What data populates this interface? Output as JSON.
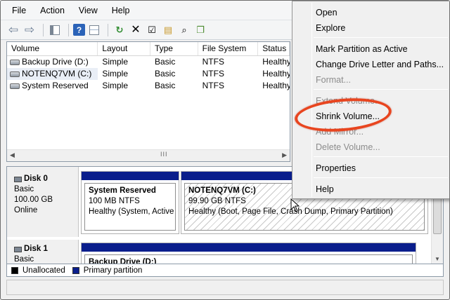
{
  "menubar": {
    "items": [
      "File",
      "Action",
      "View",
      "Help"
    ]
  },
  "toolbar": {
    "buttons": [
      "back-icon",
      "forward-icon",
      "show-hide-console-tree-icon",
      "help-icon",
      "properties-icon",
      "refresh-icon",
      "delete-icon",
      "action-icon",
      "open-icon",
      "search-icon",
      "export-icon"
    ]
  },
  "volume_list": {
    "columns": [
      "Volume",
      "Layout",
      "Type",
      "File System",
      "Status"
    ],
    "rows": [
      {
        "volume": "Backup Drive (D:)",
        "layout": "Simple",
        "type": "Basic",
        "fs": "NTFS",
        "status": "Healthy"
      },
      {
        "volume": "NOTENQ7VM (C:)",
        "layout": "Simple",
        "type": "Basic",
        "fs": "NTFS",
        "status": "Healthy"
      },
      {
        "volume": "System Reserved",
        "layout": "Simple",
        "type": "Basic",
        "fs": "NTFS",
        "status": "Healthy"
      }
    ],
    "scroll_grip": "III"
  },
  "disks": [
    {
      "name": "Disk 0",
      "type": "Basic",
      "size": "100.00 GB",
      "state": "Online",
      "partitions": [
        {
          "name": "System Reserved",
          "size_fs": "100 MB NTFS",
          "status": "Healthy (System, Active"
        },
        {
          "name": "NOTENQ7VM  (C:)",
          "size_fs": "99.90 GB NTFS",
          "status": "Healthy (Boot, Page File, Crash Dump, Primary Partition)"
        }
      ]
    },
    {
      "name": "Disk 1",
      "type": "Basic",
      "partitions": [
        {
          "name": "Backup Drive  (D:)"
        }
      ]
    }
  ],
  "legend": {
    "unallocated": "Unallocated",
    "primary": "Primary partition",
    "colors": {
      "unallocated": "#000000",
      "primary": "#0a1e8c"
    }
  },
  "context_menu": {
    "open": "Open",
    "explore": "Explore",
    "mark_active": "Mark Partition as Active",
    "change_letter": "Change Drive Letter and Paths...",
    "format": "Format...",
    "extend": "Extend Volume...",
    "shrink": "Shrink Volume...",
    "add_mirror": "Add Mirror...",
    "delete": "Delete Volume...",
    "properties": "Properties",
    "help": "Help"
  },
  "colors": {
    "highlight": "#e8451f",
    "partition_bar": "#0a1e8c"
  }
}
